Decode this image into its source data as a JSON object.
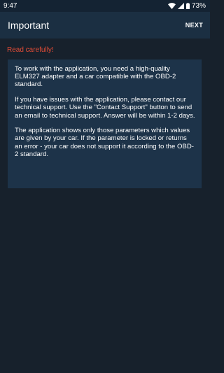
{
  "status_bar": {
    "time": "9:47",
    "battery_percent": "73%",
    "icons": [
      "wifi-icon",
      "cellular-signal-icon",
      "battery-icon"
    ]
  },
  "app_bar": {
    "title": "Important",
    "next_label": "NEXT"
  },
  "content": {
    "warning_heading": "Read carefully!",
    "paragraphs": [
      "To work with the application, you need a high-quality ELM327 adapter and a car compatible with the OBD-2 standard.",
      "If you have issues with the application, please contact our technical support. Use the \"Contact Support\" button to send an email to technical support. Answer will be within 1-2 days.",
      "The application shows only those parameters which values are given by your car. If the parameter is locked or returns an error - your car does not support it according to the OBD-2 standard."
    ]
  },
  "colors": {
    "background": "#17212c",
    "app_bar": "#1b2f42",
    "card": "#1d3349",
    "warning": "#e24c36",
    "text": "#ffffff"
  }
}
